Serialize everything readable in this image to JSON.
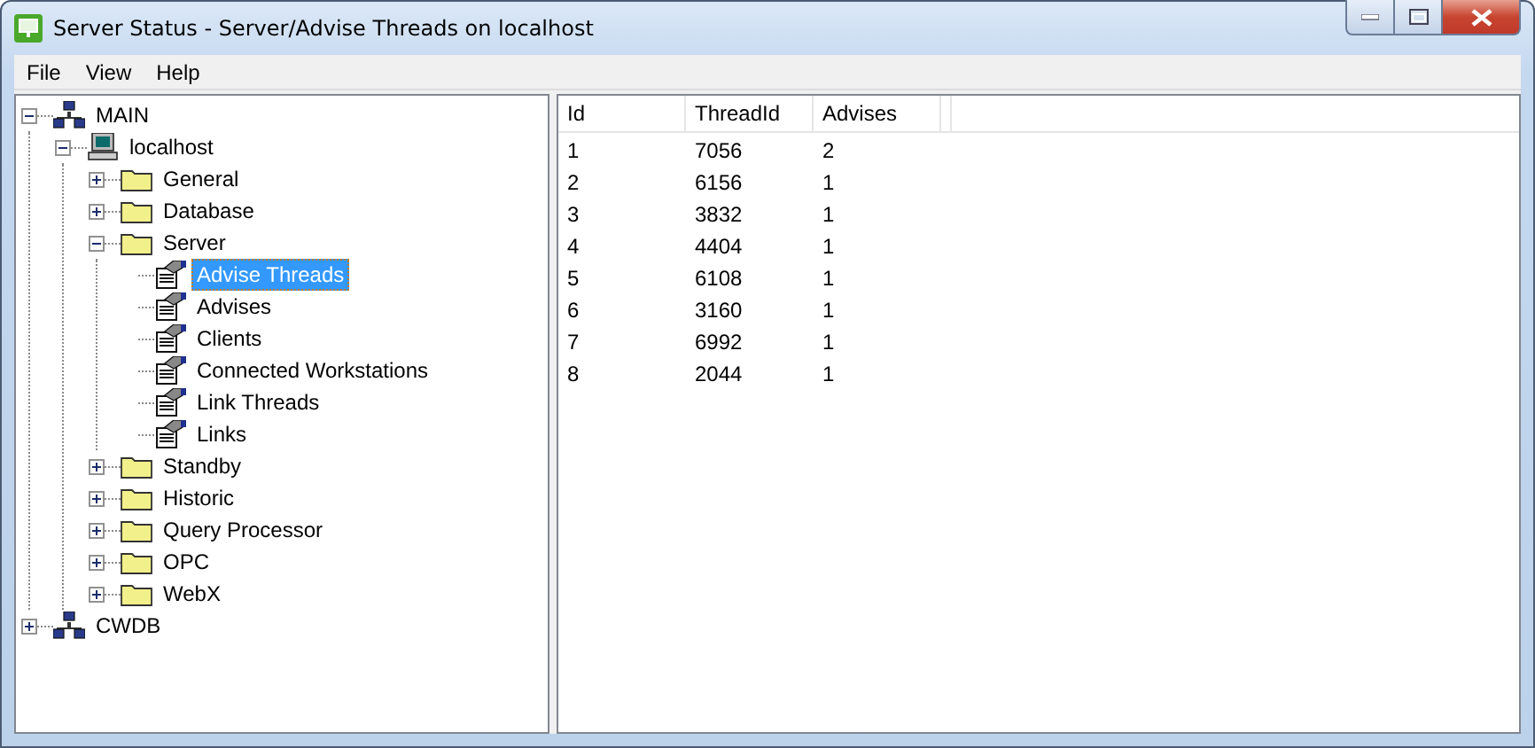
{
  "window": {
    "title": "Server Status - Server/Advise Threads on localhost"
  },
  "menu": [
    "File",
    "View",
    "Help"
  ],
  "tree": [
    {
      "label": "MAIN",
      "kind": "network",
      "expanded": true,
      "selected": false,
      "children": [
        {
          "label": "localhost",
          "kind": "computer",
          "expanded": true,
          "selected": false,
          "children": [
            {
              "label": "General",
              "kind": "folder",
              "expanded": false,
              "selected": false
            },
            {
              "label": "Database",
              "kind": "folder",
              "expanded": false,
              "selected": false
            },
            {
              "label": "Server",
              "kind": "folder",
              "expanded": true,
              "selected": false,
              "children": [
                {
                  "label": "Advise Threads",
                  "kind": "page",
                  "selected": true
                },
                {
                  "label": "Advises",
                  "kind": "page",
                  "selected": false
                },
                {
                  "label": "Clients",
                  "kind": "page",
                  "selected": false
                },
                {
                  "label": "Connected Workstations",
                  "kind": "page",
                  "selected": false
                },
                {
                  "label": "Link Threads",
                  "kind": "page",
                  "selected": false
                },
                {
                  "label": "Links",
                  "kind": "page",
                  "selected": false
                }
              ]
            },
            {
              "label": "Standby",
              "kind": "folder",
              "expanded": false,
              "selected": false
            },
            {
              "label": "Historic",
              "kind": "folder",
              "expanded": false,
              "selected": false
            },
            {
              "label": "Query Processor",
              "kind": "folder",
              "expanded": false,
              "selected": false
            },
            {
              "label": "OPC",
              "kind": "folder",
              "expanded": false,
              "selected": false
            },
            {
              "label": "WebX",
              "kind": "folder",
              "expanded": false,
              "selected": false
            }
          ]
        }
      ]
    },
    {
      "label": "CWDB",
      "kind": "network",
      "expanded": false,
      "selected": false
    }
  ],
  "table": {
    "columns": [
      "Id",
      "ThreadId",
      "Advises"
    ],
    "rows": [
      [
        "1",
        "7056",
        "2"
      ],
      [
        "2",
        "6156",
        "1"
      ],
      [
        "3",
        "3832",
        "1"
      ],
      [
        "4",
        "4404",
        "1"
      ],
      [
        "5",
        "6108",
        "1"
      ],
      [
        "6",
        "3160",
        "1"
      ],
      [
        "7",
        "6992",
        "1"
      ],
      [
        "8",
        "2044",
        "1"
      ]
    ]
  }
}
